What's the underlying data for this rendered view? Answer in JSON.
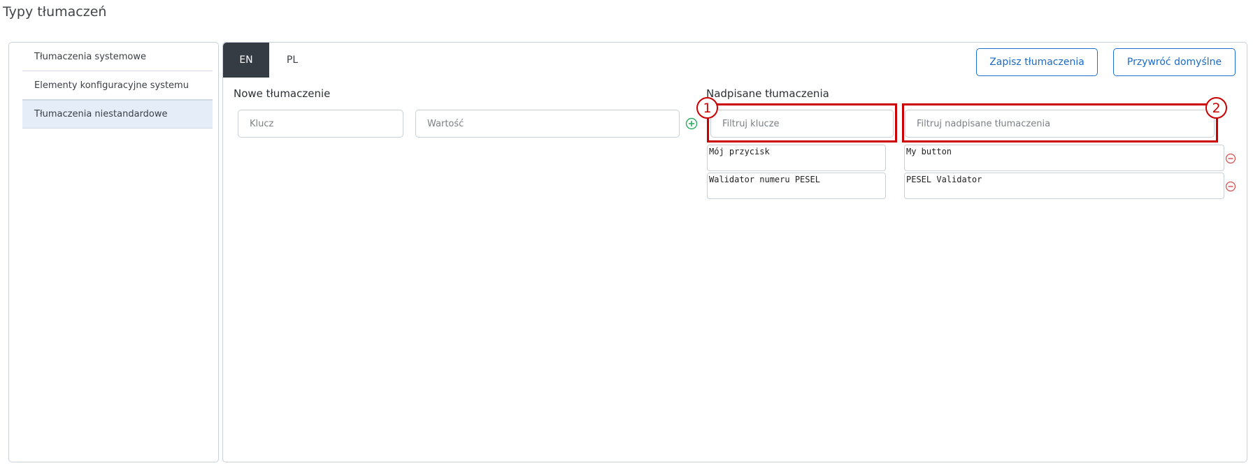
{
  "page": {
    "title": "Typy tłumaczeń"
  },
  "sidebar": {
    "items": [
      {
        "label": "Tłumaczenia systemowe",
        "active": false
      },
      {
        "label": "Elementy konfiguracyjne systemu",
        "active": false
      },
      {
        "label": "Tłumaczenia niestandardowe",
        "active": true
      }
    ]
  },
  "tabs": [
    {
      "label": "EN",
      "active": true
    },
    {
      "label": "PL",
      "active": false
    }
  ],
  "toolbar": {
    "save_label": "Zapisz tłumaczenia",
    "restore_label": "Przywróć domyślne"
  },
  "new_translation": {
    "title": "Nowe tłumaczenie",
    "key_placeholder": "Klucz",
    "value_placeholder": "Wartość",
    "add_icon": "plus-circle-icon"
  },
  "overridden": {
    "title": "Nadpisane tłumaczenia",
    "filter_keys_placeholder": "Filtruj klucze",
    "filter_translations_placeholder": "Filtruj nadpisane tłumaczenia",
    "rows": [
      {
        "key": "Mój przycisk",
        "value": "My button"
      },
      {
        "key": "Walidator numeru PESEL",
        "value": "PESEL Validator"
      }
    ],
    "delete_icon": "minus-circle-icon"
  },
  "annotations": {
    "marker_1": "1",
    "marker_2": "2",
    "color": "#cc0000"
  },
  "colors": {
    "accent": "#1e6fd0",
    "tab_active_bg": "#353c44",
    "sidebar_active_bg": "#e4edf8",
    "add_icon": "#2eab5e",
    "delete_icon": "#d9534f"
  }
}
